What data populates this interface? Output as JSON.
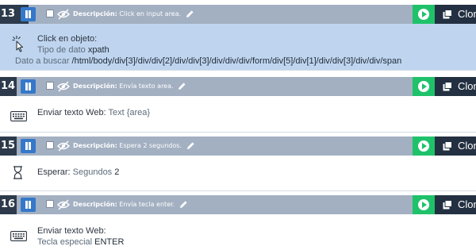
{
  "steps": [
    {
      "number": "13",
      "desc_key": "Descripción:",
      "desc_value": "Click en input area.",
      "clone_label": "Clon",
      "action_title": "Click en objeto:",
      "line2_key": "Tipo de dato",
      "line2_value": "xpath",
      "line3_key": "Dato a buscar",
      "line3_value": "/html/body/div[3]/div/div[2]/div/div[3]/div/div/div/form/div[5]/div[1]/div/div[3]/div/div/span",
      "icon": "pointer-click-icon",
      "selected": true
    },
    {
      "number": "14",
      "desc_key": "Descripción:",
      "desc_value": "Envía texto area.",
      "clone_label": "Clon",
      "action_key": "Enviar texto Web:",
      "action_value": "Text {area}",
      "icon": "keyboard-icon"
    },
    {
      "number": "15",
      "desc_key": "Descripción:",
      "desc_value": "Espera 2 segundos.",
      "clone_label": "Clon",
      "action_key": "Esperar:",
      "action_sub": "Segundos",
      "action_value": "2",
      "icon": "hourglass-icon"
    },
    {
      "number": "16",
      "desc_key": "Descripción:",
      "desc_value": "Envía tecla enter.",
      "clone_label": "Clon",
      "action_title": "Enviar texto Web:",
      "line2_key": "Tecla especial",
      "line2_value": "ENTER",
      "icon": "keyboard-icon"
    }
  ],
  "colors": {
    "header_bar": "#a3b0c2",
    "number_bg": "#2c3a4b",
    "pause_button": "#3578c9",
    "play_button": "#1fc26a",
    "clone_button": "#233041",
    "selected_row": "#bfd5ef"
  }
}
